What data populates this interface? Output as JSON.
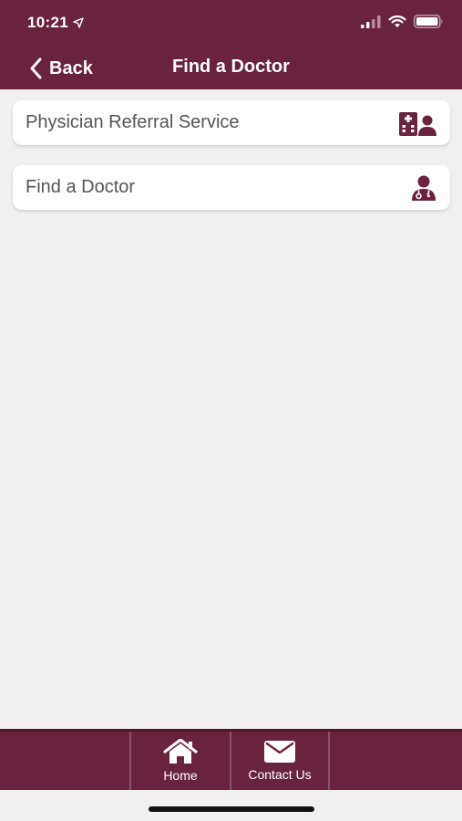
{
  "status_bar": {
    "time": "10:21",
    "icons": [
      "location-arrow-icon",
      "cellular-signal-icon",
      "wifi-icon",
      "battery-icon"
    ]
  },
  "nav": {
    "back_label": "Back",
    "title": "Find a Doctor"
  },
  "list": {
    "items": [
      {
        "label": "Physician Referral Service",
        "icon": "hospital-user-icon"
      },
      {
        "label": "Find a Doctor",
        "icon": "doctor-icon"
      }
    ]
  },
  "tabbar": {
    "tabs": [
      {
        "label": "Home",
        "icon": "home-icon"
      },
      {
        "label": "Contact Us",
        "icon": "envelope-icon"
      }
    ]
  },
  "colors": {
    "brand": "#69233f",
    "background": "#f2f0ee",
    "card": "#ffffff",
    "card_text": "#555555"
  }
}
